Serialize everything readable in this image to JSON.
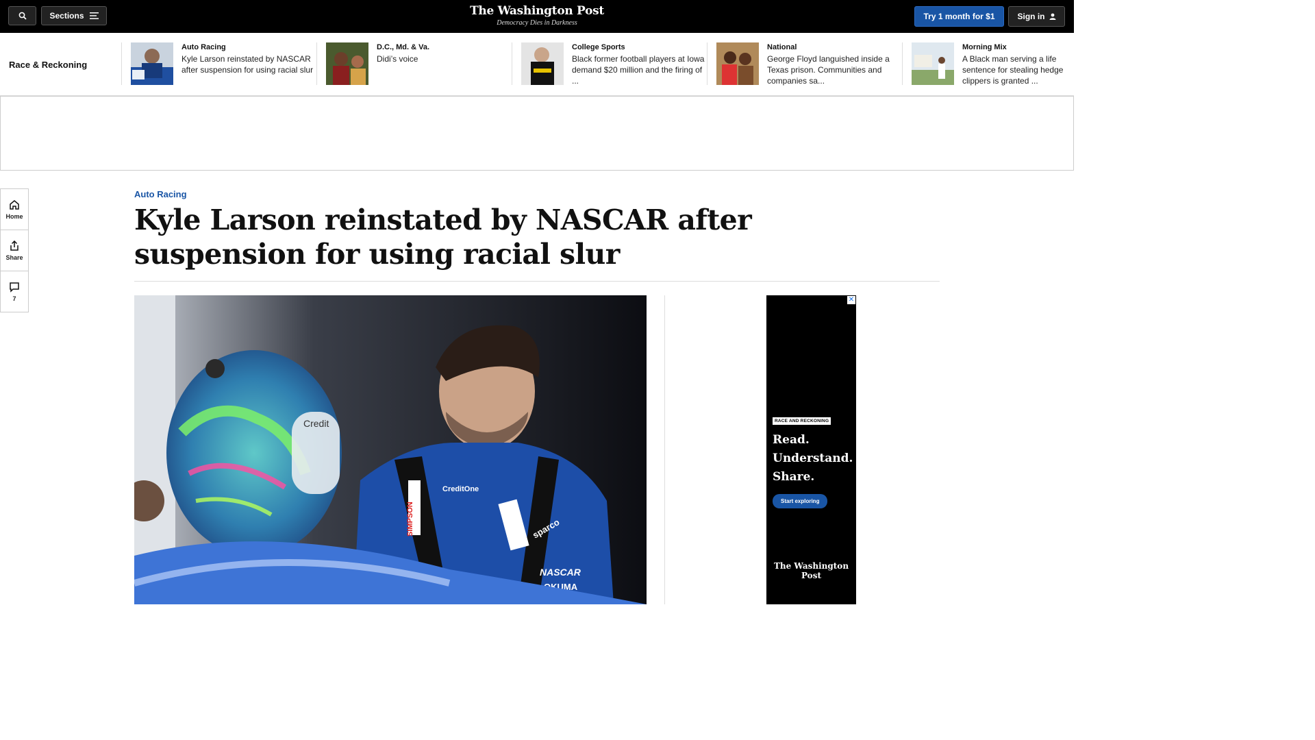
{
  "header": {
    "sections_label": "Sections",
    "logo_text": "The Washington Post",
    "tagline": "Democracy Dies in Darkness",
    "subscribe_label": "Try 1 month for $1",
    "signin_label": "Sign in"
  },
  "strip": {
    "title": "Race & Reckoning",
    "items": [
      {
        "kicker": "Auto Racing",
        "headline": "Kyle Larson reinstated by NASCAR after suspension for using racial slur"
      },
      {
        "kicker": "D.C., Md. & Va.",
        "headline": "Didi’s voice"
      },
      {
        "kicker": "College Sports",
        "headline": "Black former football players at Iowa demand $20 million and the firing of ..."
      },
      {
        "kicker": "National",
        "headline": "George Floyd languished inside a Texas prison. Communities and companies sa..."
      },
      {
        "kicker": "Morning Mix",
        "headline": "A Black man serving a life sentence for stealing hedge clippers is granted ..."
      }
    ]
  },
  "rail": {
    "home_label": "Home",
    "share_label": "Share",
    "comments_count": "7"
  },
  "article": {
    "kicker": "Auto Racing",
    "headline": "Kyle Larson reinstated by NASCAR after suspension for using racial slur"
  },
  "ad": {
    "badge": "RACE AND RECKONING",
    "line1": "Read.",
    "line2": "Understand.",
    "line3": "Share.",
    "cta": "Start exploring",
    "logo": "The Washington Post"
  },
  "photo_text": {
    "sponsor1": "CreditOne",
    "sponsor2": "NASCAR",
    "sponsor3": "SIMPSON",
    "sponsor4": "sparco",
    "sponsor5": "OKUMA",
    "helmet": "Credit"
  }
}
